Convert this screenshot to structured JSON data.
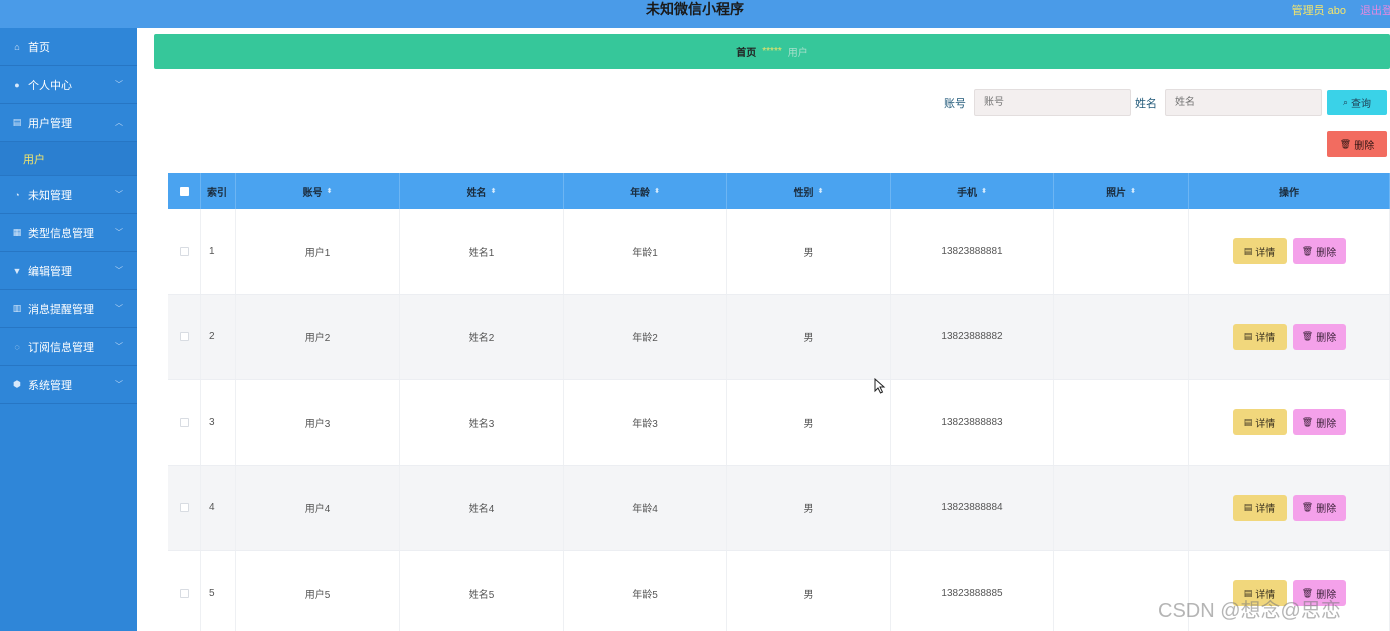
{
  "header": {
    "title": "未知微信小程序",
    "admin": "管理员 abo",
    "logout": "退出登录"
  },
  "sidebar": {
    "items": [
      {
        "label": "首页",
        "icon": "home-icon",
        "glyph": "⌂"
      },
      {
        "label": "个人中心",
        "icon": "user-icon",
        "glyph": "●",
        "chevron": "﹀"
      },
      {
        "label": "用户管理",
        "icon": "clipboard-icon",
        "glyph": "▤",
        "chevron": "︿"
      },
      {
        "label": "未知管理",
        "icon": "circle-icon",
        "glyph": "◔",
        "chevron": "﹀"
      },
      {
        "label": "类型信息管理",
        "icon": "grid-icon",
        "glyph": "▦",
        "chevron": "﹀"
      },
      {
        "label": "编辑管理",
        "icon": "shield-icon",
        "glyph": "▼",
        "chevron": "﹀"
      },
      {
        "label": "消息提醒管理",
        "icon": "bar-chart-icon",
        "glyph": "▥",
        "chevron": "﹀"
      },
      {
        "label": "订阅信息管理",
        "icon": "bell-icon",
        "glyph": "◌",
        "chevron": "﹀"
      },
      {
        "label": "系统管理",
        "icon": "gear-icon",
        "glyph": "⬢",
        "chevron": "﹀"
      }
    ],
    "sub_active": "用户"
  },
  "breadcrumb": {
    "home": "首页",
    "sep": "*****",
    "current": "用户"
  },
  "search": {
    "account_label": "账号",
    "account_placeholder": "账号",
    "name_label": "姓名",
    "name_placeholder": "姓名",
    "query_label": "查询",
    "query_icon": "search-icon",
    "delete_label": "删除",
    "delete_icon": "trash-icon"
  },
  "table": {
    "columns": [
      {
        "label": "索引"
      },
      {
        "label": "账号"
      },
      {
        "label": "姓名"
      },
      {
        "label": "年龄"
      },
      {
        "label": "性别"
      },
      {
        "label": "手机"
      },
      {
        "label": "照片"
      },
      {
        "label": "操作"
      }
    ],
    "sort_icon": "⬍",
    "rows": [
      {
        "index": "1",
        "account": "用户1",
        "name": "姓名1",
        "age": "年龄1",
        "gender": "男",
        "phone": "13823888881",
        "photo": ""
      },
      {
        "index": "2",
        "account": "用户2",
        "name": "姓名2",
        "age": "年龄2",
        "gender": "男",
        "phone": "13823888882",
        "photo": ""
      },
      {
        "index": "3",
        "account": "用户3",
        "name": "姓名3",
        "age": "年龄3",
        "gender": "男",
        "phone": "13823888883",
        "photo": ""
      },
      {
        "index": "4",
        "account": "用户4",
        "name": "姓名4",
        "age": "年龄4",
        "gender": "男",
        "phone": "13823888884",
        "photo": ""
      },
      {
        "index": "5",
        "account": "用户5",
        "name": "姓名5",
        "age": "年龄5",
        "gender": "男",
        "phone": "13823888885",
        "photo": ""
      }
    ],
    "detail_label": "详情",
    "row_delete_label": "删除"
  },
  "watermark": "CSDN @想念@思恋",
  "colors": {
    "header": "#4a9be8",
    "sidebar": "#2f86d8",
    "breadcrumb": "#36c79a",
    "table_head": "#4aa3f0",
    "detail_btn": "#f1d77c",
    "delete_btn": "#f4a1ea",
    "query_btn": "#3ad2e8",
    "danger_btn": "#f26c60"
  }
}
